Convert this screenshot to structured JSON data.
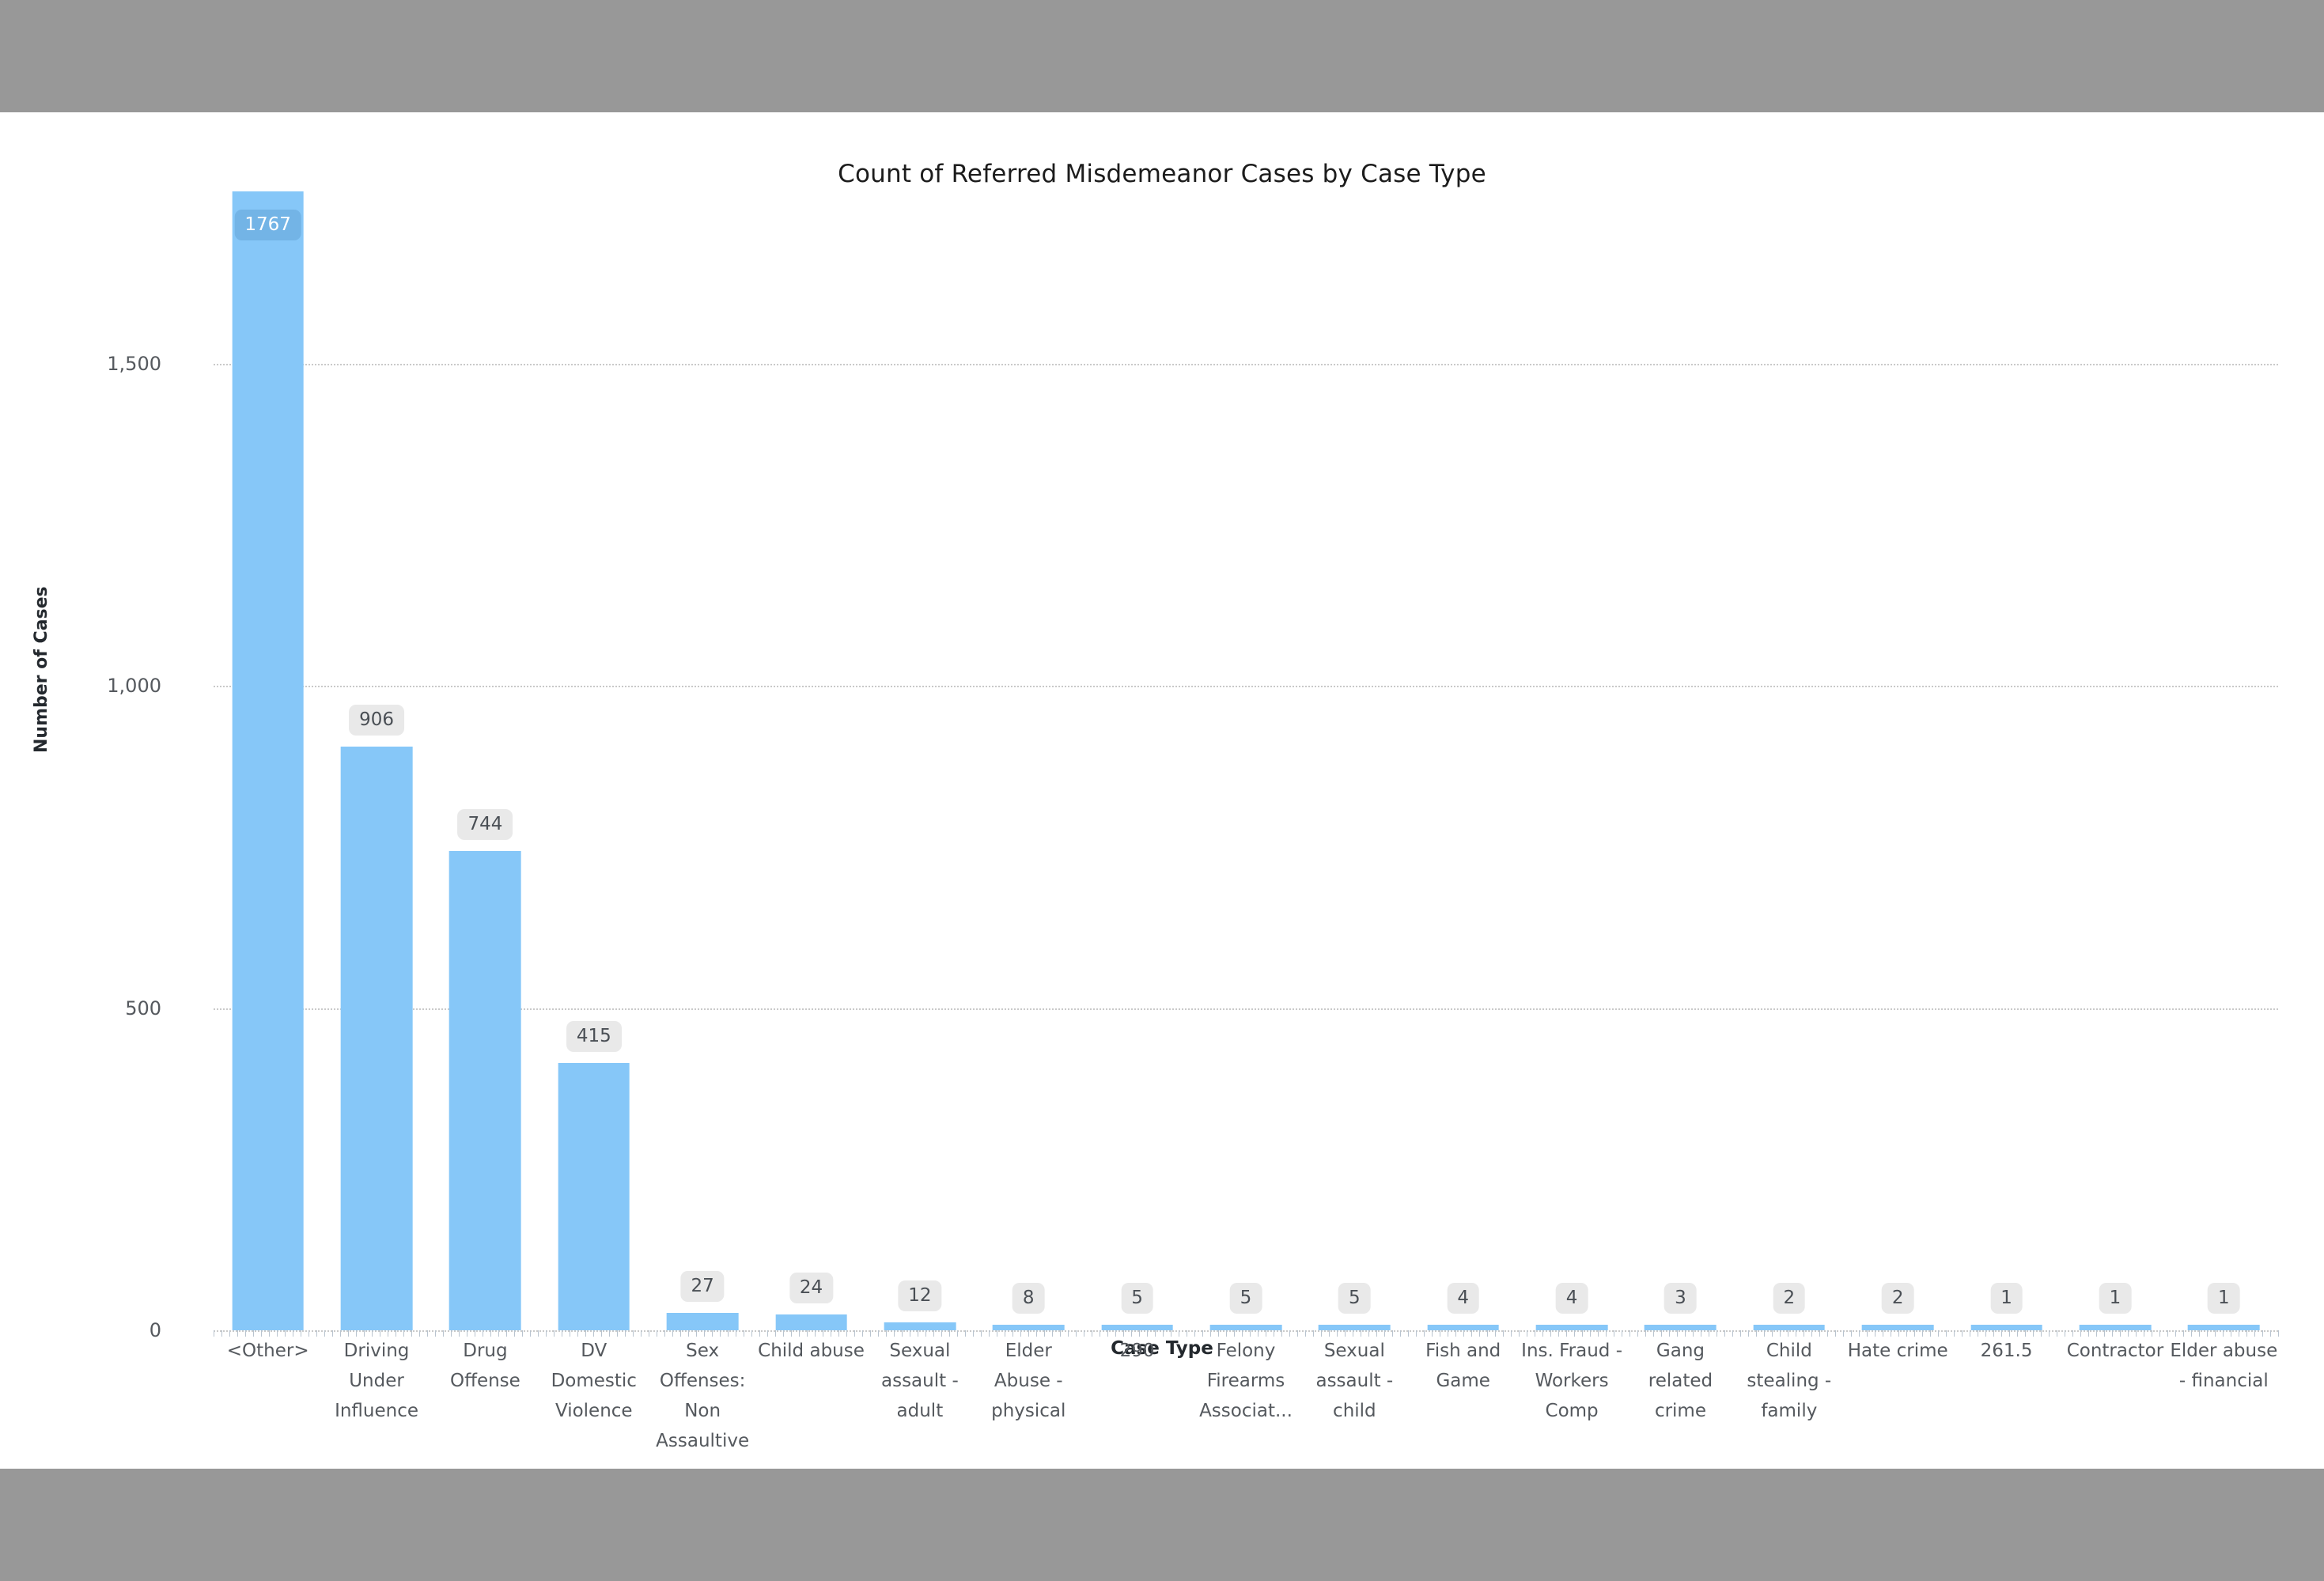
{
  "chart_data": {
    "type": "bar",
    "title": "Count of Referred Misdemeanor Cases by Case Type",
    "xlabel": "Case Type",
    "ylabel": "Number of Cases",
    "ylim": [
      0,
      1767
    ],
    "grid": true,
    "legend": "none",
    "orientation": "vertical",
    "bar_color": "#86C7F8",
    "yticks": [
      "0",
      "500",
      "1,000",
      "1,500"
    ],
    "ytick_values": [
      0,
      500,
      1000,
      1500
    ],
    "categories": [
      "<Other>",
      "Driving Under Influence",
      "Drug Offense",
      "DV Domestic Violence",
      "Sex Offenses: Non Assaultive",
      "Child abuse",
      "Sexual assault - adult",
      "Elder Abuse - physical",
      "290",
      "Felony Firearms Associat...",
      "Sexual assault - child",
      "Fish and Game",
      "Ins. Fraud - Workers Comp",
      "Gang related crime",
      "Child stealing - family",
      "Hate crime",
      "261.5",
      "Contractor",
      "Elder abuse - financial"
    ],
    "values": [
      1767,
      906,
      744,
      415,
      27,
      24,
      12,
      8,
      5,
      5,
      5,
      4,
      4,
      3,
      2,
      2,
      1,
      1,
      1
    ],
    "value_labels": [
      "1767",
      "906",
      "744",
      "415",
      "27",
      "24",
      "12",
      "8",
      "5",
      "5",
      "5",
      "4",
      "4",
      "3",
      "2",
      "2",
      "1",
      "1",
      "1"
    ]
  }
}
